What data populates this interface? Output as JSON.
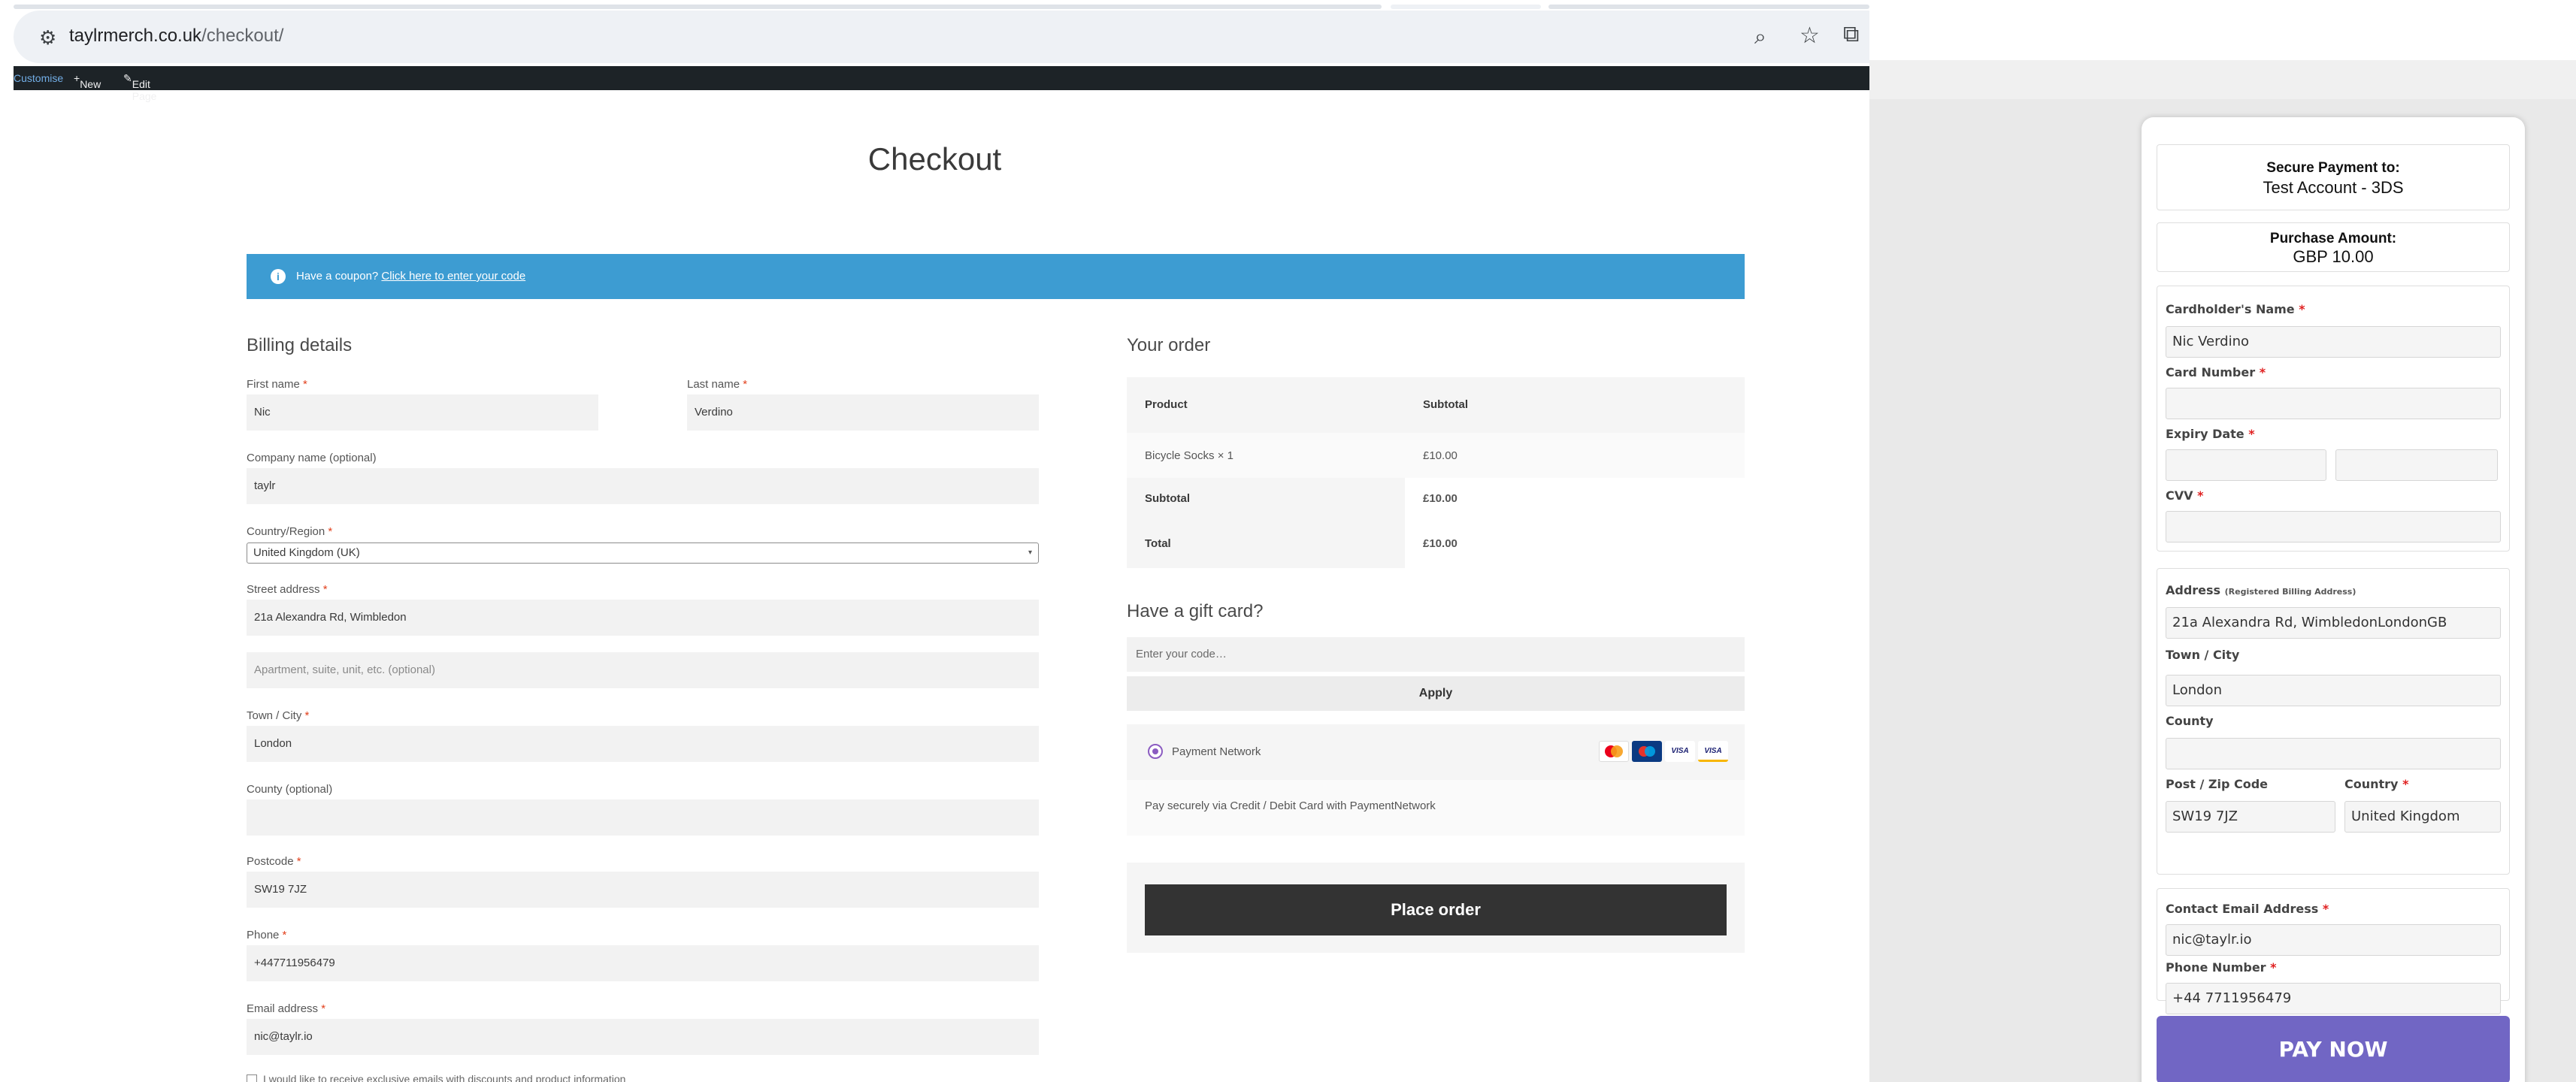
{
  "browser": {
    "url_host": "taylrmerch.co.uk",
    "url_path": "/checkout/"
  },
  "adminbar": {
    "customise": "Customise",
    "new": "New",
    "edit_page": "Edit Page"
  },
  "page": {
    "title": "Checkout"
  },
  "coupon": {
    "prompt": "Have a coupon?",
    "link": "Click here to enter your code"
  },
  "billing": {
    "heading": "Billing details",
    "first_name_label": "First name",
    "first_name": "Nic",
    "last_name_label": "Last name",
    "last_name": "Verdino",
    "company_label": "Company name (optional)",
    "company": "taylr",
    "country_label": "Country/Region",
    "country": "United Kingdom (UK)",
    "street_label": "Street address",
    "street": "21a Alexandra Rd, Wimbledon",
    "apartment_placeholder": "Apartment, suite, unit, etc. (optional)",
    "town_label": "Town / City",
    "town": "London",
    "county_label": "County (optional)",
    "county": "",
    "postcode_label": "Postcode",
    "postcode": "SW19 7JZ",
    "phone_label": "Phone",
    "phone": "+447711956479",
    "email_label": "Email address",
    "email": "nic@taylr.io",
    "newsletter_label": "I would like to receive exclusive emails with discounts and product information"
  },
  "order": {
    "heading": "Your order",
    "col_product": "Product",
    "col_subtotal": "Subtotal",
    "item_name": "Bicycle Socks",
    "item_qty": "× 1",
    "item_price": "£10.00",
    "subtotal_label": "Subtotal",
    "subtotal_value": "£10.00",
    "total_label": "Total",
    "total_value": "£10.00"
  },
  "gift": {
    "heading": "Have a gift card?",
    "placeholder": "Enter your code…",
    "apply": "Apply"
  },
  "payment": {
    "method": "Payment Network",
    "description": "Pay securely via Credit / Debit Card with PaymentNetwork",
    "card_brands": [
      "mastercard",
      "maestro",
      "VISA",
      "VISA"
    ],
    "place_order": "Place order"
  },
  "gateway": {
    "secure_title": "Secure Payment to:",
    "merchant": "Test Account - 3DS",
    "amount_title": "Purchase Amount:",
    "amount": "GBP 10.00",
    "cardholder_label": "Cardholder's Name",
    "cardholder": "Nic Verdino",
    "card_number_label": "Card Number",
    "card_number": "",
    "expiry_label": "Expiry Date",
    "cvv_label": "CVV",
    "address_label": "Address",
    "address_note": "(Registered Billing Address)",
    "address": "21a Alexandra Rd, WimbledonLondonGB",
    "town_label": "Town / City",
    "town": "London",
    "county_label": "County",
    "county": "",
    "postcode_label": "Post / Zip Code",
    "postcode": "SW19 7JZ",
    "country_label": "Country",
    "country": "United Kingdom",
    "email_label": "Contact Email Address",
    "email": "nic@taylr.io",
    "phone_label": "Phone Number",
    "phone": "+44 7711956479",
    "pay_now": "PAY NOW"
  },
  "colors": {
    "coupon_bar": "#3d9cd2",
    "place_order": "#333333",
    "pay_now": "#7166c4",
    "admin_bar": "#1d2327",
    "required": "#e2401c"
  }
}
